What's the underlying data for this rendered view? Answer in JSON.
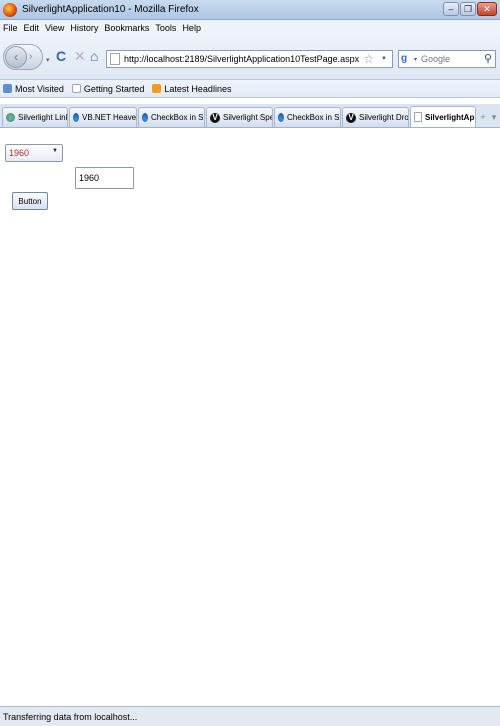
{
  "window": {
    "title": "SilverlightApplication10 - Mozilla Firefox",
    "minimize": "–",
    "maximize": "❐",
    "close": "✕"
  },
  "menu": [
    "File",
    "Edit",
    "View",
    "History",
    "Bookmarks",
    "Tools",
    "Help"
  ],
  "nav": {
    "url": "http://localhost:2189/SilverlightApplication10TestPage.aspx",
    "search_placeholder": "Google"
  },
  "bookmarks": [
    "Most Visited",
    "Getting Started",
    "Latest Headlines"
  ],
  "tabs": [
    {
      "label": "Silverlight LinkLab...",
      "icon": "globe-icon"
    },
    {
      "label": "VB.NET Heaven: F...",
      "icon": "silverlight-icon"
    },
    {
      "label": "CheckBox in Silver...",
      "icon": "silverlight-icon"
    },
    {
      "label": "Silverlight Spell C...",
      "icon": "v-logo-icon"
    },
    {
      "label": "CheckBox in Silver...",
      "icon": "silverlight-icon"
    },
    {
      "label": "Silverlight Dropdo...",
      "icon": "v-logo-icon"
    },
    {
      "label": "SilverlightAp...",
      "icon": "page-icon",
      "active": true,
      "close": "x"
    }
  ],
  "tab_scroll": {
    "add": "+",
    "list": "▾"
  },
  "content": {
    "combo_value": "1960",
    "textbox_value": "1960",
    "button_label": "Button"
  },
  "status": {
    "text": "Transferring data from localhost..."
  }
}
